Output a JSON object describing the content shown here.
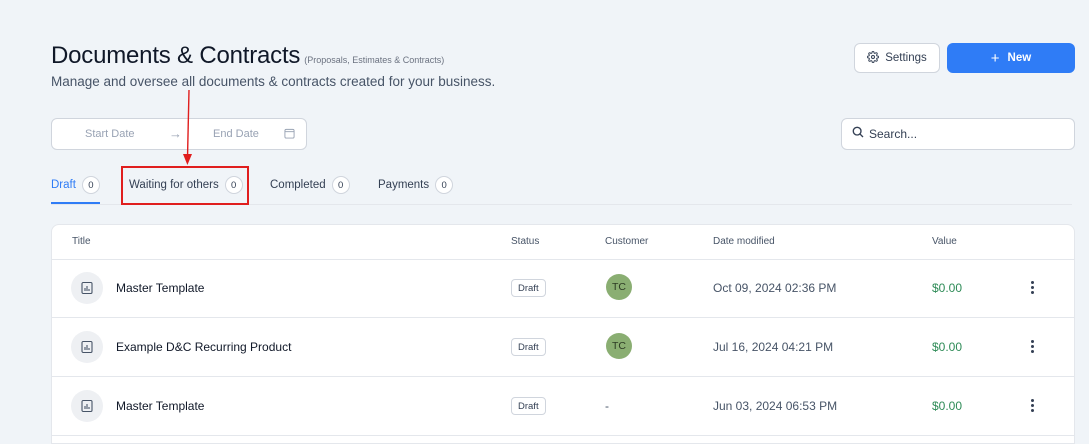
{
  "header": {
    "title": "Documents & Contracts",
    "subtitle": "(Proposals, Estimates & Contracts)",
    "description": "Manage and oversee all documents & contracts created for your business.",
    "settings_label": "Settings",
    "new_label": "New",
    "new_icon": "+"
  },
  "filters": {
    "start_date_placeholder": "Start Date",
    "end_date_placeholder": "End Date",
    "arrow": "→",
    "search_placeholder": "Search..."
  },
  "tabs": [
    {
      "label": "Draft",
      "count": "0",
      "active": true
    },
    {
      "label": "Waiting for others",
      "count": "0",
      "active": false
    },
    {
      "label": "Completed",
      "count": "0",
      "active": false
    },
    {
      "label": "Payments",
      "count": "0",
      "active": false
    }
  ],
  "table": {
    "columns": [
      "Title",
      "Status",
      "Customer",
      "Date modified",
      "Value"
    ],
    "rows": [
      {
        "title": "Master Template",
        "status": "Draft",
        "customer": "TC",
        "date": "Oct 09, 2024 02:36 PM",
        "value": "$0.00"
      },
      {
        "title": "Example D&C Recurring Product",
        "status": "Draft",
        "customer": "TC",
        "date": "Jul 16, 2024 04:21 PM",
        "value": "$0.00"
      },
      {
        "title": "Master Template",
        "status": "Draft",
        "customer": "-",
        "date": "Jun 03, 2024 06:53 PM",
        "value": "$0.00"
      }
    ]
  },
  "colors": {
    "accent": "#2f7cf6",
    "value_green": "#2e8b57",
    "avatar_bg": "#8aae72",
    "annotation_red": "#e01e1e"
  }
}
